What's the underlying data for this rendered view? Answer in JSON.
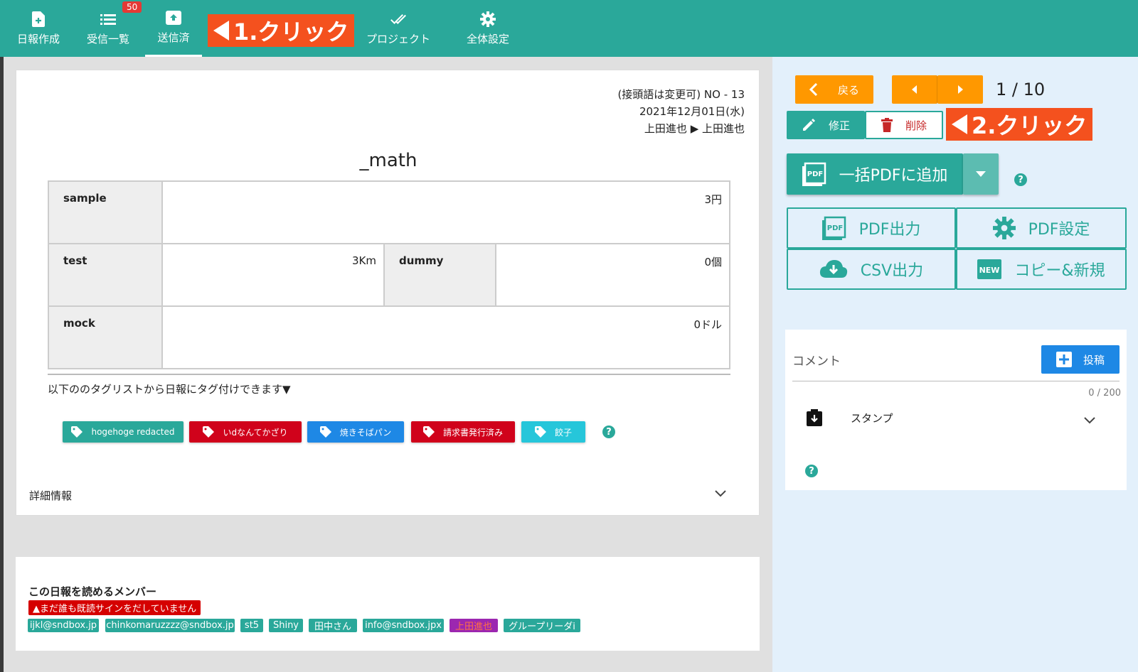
{
  "nav": {
    "items": [
      {
        "label": "日報作成"
      },
      {
        "label": "受信一覧",
        "badge": "50"
      },
      {
        "label": "送信済"
      },
      {
        "label": "プロジェクト"
      },
      {
        "label": "全体設定"
      }
    ]
  },
  "annotations": {
    "step1": "1.クリック",
    "step2": "2.クリック"
  },
  "report": {
    "meta_line1": "(接頭語は変更可) NO - 13",
    "meta_line2": "2021年12月01日(水)",
    "meta_line3": "上田進也 ▶ 上田進也",
    "title": "_math",
    "rows": [
      {
        "label": "sample",
        "value": "3円"
      },
      {
        "label": "test",
        "value": "3Km",
        "label2": "dummy",
        "value2": "0個"
      },
      {
        "label": "mock",
        "value": "0ドル"
      }
    ],
    "tag_hint": "以下ののタグリストから日報にタグ付けできます▼",
    "tags": [
      {
        "label": "hogehoge redacted",
        "color": "#2aa89a"
      },
      {
        "label": "いdなんてかざり",
        "color": "#d0021b"
      },
      {
        "label": "焼きそばパン",
        "color": "#1e88e5"
      },
      {
        "label": "請求書発行済み",
        "color": "#d0021b"
      },
      {
        "label": "餃子",
        "color": "#26c6da"
      }
    ],
    "detail_label": "詳細情報"
  },
  "members": {
    "title": "この日報を読めるメンバー",
    "warning": "▲まだ誰も既読サインをだしていません",
    "list": [
      {
        "label": "ijkl@sndbox.jp",
        "color": "#2aa89a"
      },
      {
        "label": "chinkomaruzzzz@sndbox.jp",
        "color": "#2aa89a"
      },
      {
        "label": "st5",
        "color": "#2aa89a"
      },
      {
        "label": "Shiny",
        "color": "#2aa89a"
      },
      {
        "label": "田中さん",
        "color": "#2aa89a"
      },
      {
        "label": "info@sndbox.jpx",
        "color": "#2aa89a"
      },
      {
        "label": "上田進也",
        "color": "#9c27b0"
      },
      {
        "label": "グループリーダi",
        "color": "#2aa89a"
      }
    ]
  },
  "actions": {
    "back": "戻る",
    "page": "1 / 10",
    "edit": "修正",
    "delete": "削除",
    "bulk_pdf": "一括PDFに追加",
    "pdf_out": "PDF出力",
    "pdf_settings": "PDF設定",
    "csv_out": "CSV出力",
    "copy_new": "コピー&新規"
  },
  "comment": {
    "label": "コメント",
    "post": "投稿",
    "counter": "0 / 200",
    "stamp": "スタンプ"
  }
}
